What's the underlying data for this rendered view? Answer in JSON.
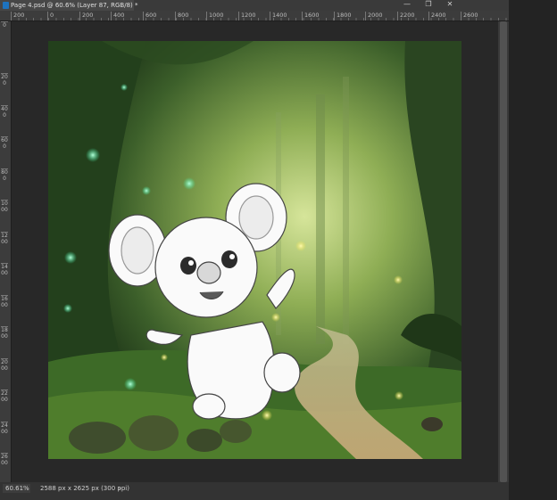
{
  "document": {
    "tab_title": "Page 4.psd @ 60.6% (Layer 87, RGB/8) *"
  },
  "window_controls": {
    "minimize": "—",
    "restore": "❐",
    "close": "✕"
  },
  "ruler_horizontal": {
    "labels": [
      "200",
      "0",
      "200",
      "400",
      "600",
      "800",
      "1000",
      "1200",
      "1400",
      "1600",
      "1800",
      "2000",
      "2200",
      "2400",
      "2600"
    ]
  },
  "ruler_vertical": {
    "labels": [
      "0",
      "200",
      "400",
      "600",
      "800",
      "1000",
      "1200",
      "1400",
      "1600",
      "1800",
      "2000",
      "2200",
      "2400",
      "2600"
    ]
  },
  "statusbar": {
    "zoom": "60.61%",
    "doc_info": "2588 px x 2625 px (300 ppi)",
    "menu_arrow": "›"
  },
  "colors": {
    "workspace": "#282828",
    "accent": "#1e73be",
    "forest_dark": "#1f3a1a",
    "forest_light": "#bcd27a",
    "firefly_green": "#39e6a0",
    "firefly_yellow": "#f2e24a"
  }
}
